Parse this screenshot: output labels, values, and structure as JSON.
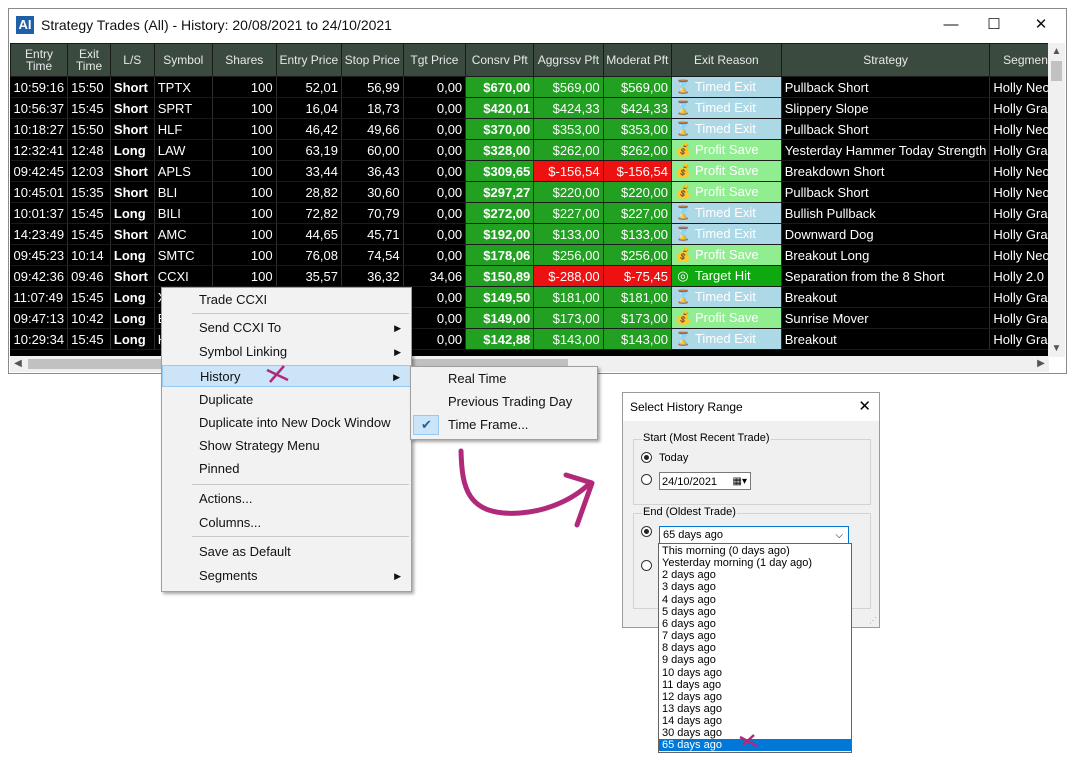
{
  "window": {
    "app_icon_label": "AI",
    "title": "Strategy Trades (All) - History: 20/08/2021 to 24/10/2021",
    "minimize_glyph": "—",
    "maximize_glyph": "☐",
    "close_glyph": "✕"
  },
  "grid": {
    "headers": [
      "Entry Time",
      "Exit Time",
      "L/S",
      "Symbol",
      "Shares",
      "Entry Price",
      "Stop Price",
      "Tgt Price",
      "Consrv Pft",
      "Aggrssv Pft",
      "Moderat Pft",
      "Exit Reason",
      "Strategy",
      "Segment"
    ],
    "rows": [
      {
        "entry": "10:59:16",
        "exit": "15:50",
        "ls": "Short",
        "symbol": "TPTX",
        "shares": "100",
        "entry_price": "52,01",
        "stop": "56,99",
        "tgt": "0,00",
        "cons": "$670,00",
        "aggr": "$569,00",
        "mod": "$569,00",
        "aggr_neg": false,
        "mod_neg": false,
        "reason": "Timed Exit",
        "reason_type": "timed",
        "strategy": "Pullback Short",
        "segment": "Holly Neo"
      },
      {
        "entry": "10:56:37",
        "exit": "15:45",
        "ls": "Short",
        "symbol": "SPRT",
        "shares": "100",
        "entry_price": "16,04",
        "stop": "18,73",
        "tgt": "0,00",
        "cons": "$420,01",
        "aggr": "$424,33",
        "mod": "$424,33",
        "aggr_neg": false,
        "mod_neg": false,
        "reason": "Timed Exit",
        "reason_type": "timed",
        "strategy": "Slippery Slope",
        "segment": "Holly Grail"
      },
      {
        "entry": "10:18:27",
        "exit": "15:50",
        "ls": "Short",
        "symbol": "HLF",
        "shares": "100",
        "entry_price": "46,42",
        "stop": "49,66",
        "tgt": "0,00",
        "cons": "$370,00",
        "aggr": "$353,00",
        "mod": "$353,00",
        "aggr_neg": false,
        "mod_neg": false,
        "reason": "Timed Exit",
        "reason_type": "timed",
        "strategy": "Pullback Short",
        "segment": "Holly Neo"
      },
      {
        "entry": "12:32:41",
        "exit": "12:48",
        "ls": "Long",
        "symbol": "LAW",
        "shares": "100",
        "entry_price": "63,19",
        "stop": "60,00",
        "tgt": "0,00",
        "cons": "$328,00",
        "aggr": "$262,00",
        "mod": "$262,00",
        "aggr_neg": false,
        "mod_neg": false,
        "reason": "Profit Save",
        "reason_type": "profit",
        "strategy": "Yesterday Hammer Today Strength",
        "segment": "Holly Grail"
      },
      {
        "entry": "09:42:45",
        "exit": "12:03",
        "ls": "Short",
        "symbol": "APLS",
        "shares": "100",
        "entry_price": "33,44",
        "stop": "36,43",
        "tgt": "0,00",
        "cons": "$309,65",
        "aggr": "$-156,54",
        "mod": "$-156,54",
        "aggr_neg": true,
        "mod_neg": true,
        "reason": "Profit Save",
        "reason_type": "profit",
        "strategy": "Breakdown Short",
        "segment": "Holly Neo"
      },
      {
        "entry": "10:45:01",
        "exit": "15:35",
        "ls": "Short",
        "symbol": "BLI",
        "shares": "100",
        "entry_price": "28,82",
        "stop": "30,60",
        "tgt": "0,00",
        "cons": "$297,27",
        "aggr": "$220,00",
        "mod": "$220,00",
        "aggr_neg": false,
        "mod_neg": false,
        "reason": "Profit Save",
        "reason_type": "profit",
        "strategy": "Pullback Short",
        "segment": "Holly Neo"
      },
      {
        "entry": "10:01:37",
        "exit": "15:45",
        "ls": "Long",
        "symbol": "BILI",
        "shares": "100",
        "entry_price": "72,82",
        "stop": "70,79",
        "tgt": "0,00",
        "cons": "$272,00",
        "aggr": "$227,00",
        "mod": "$227,00",
        "aggr_neg": false,
        "mod_neg": false,
        "reason": "Timed Exit",
        "reason_type": "timed",
        "strategy": "Bullish Pullback",
        "segment": "Holly Grail"
      },
      {
        "entry": "14:23:49",
        "exit": "15:45",
        "ls": "Short",
        "symbol": "AMC",
        "shares": "100",
        "entry_price": "44,65",
        "stop": "45,71",
        "tgt": "0,00",
        "cons": "$192,00",
        "aggr": "$133,00",
        "mod": "$133,00",
        "aggr_neg": false,
        "mod_neg": false,
        "reason": "Timed Exit",
        "reason_type": "timed",
        "strategy": "Downward Dog",
        "segment": "Holly Grail"
      },
      {
        "entry": "09:45:23",
        "exit": "10:14",
        "ls": "Long",
        "symbol": "SMTC",
        "shares": "100",
        "entry_price": "76,08",
        "stop": "74,54",
        "tgt": "0,00",
        "cons": "$178,06",
        "aggr": "$256,00",
        "mod": "$256,00",
        "aggr_neg": false,
        "mod_neg": false,
        "reason": "Profit Save",
        "reason_type": "profit",
        "strategy": "Breakout Long",
        "segment": "Holly Neo"
      },
      {
        "entry": "09:42:36",
        "exit": "09:46",
        "ls": "Short",
        "symbol": "CCXI",
        "shares": "100",
        "entry_price": "35,57",
        "stop": "36,32",
        "tgt": "34,06",
        "cons": "$150,89",
        "aggr": "$-288,00",
        "mod": "$-75,45",
        "aggr_neg": true,
        "mod_neg": true,
        "reason": "Target Hit",
        "reason_type": "target",
        "strategy": "Separation from the 8 Short",
        "segment": "Holly 2.0"
      },
      {
        "entry": "11:07:49",
        "exit": "15:45",
        "ls": "Long",
        "symbol": "X",
        "shares": "",
        "entry_price": "",
        "stop": "",
        "tgt": "0,00",
        "cons": "$149,50",
        "aggr": "$181,00",
        "mod": "$181,00",
        "aggr_neg": false,
        "mod_neg": false,
        "reason": "Timed Exit",
        "reason_type": "timed",
        "strategy": "Breakout",
        "segment": "Holly Grail"
      },
      {
        "entry": "09:47:13",
        "exit": "10:42",
        "ls": "Long",
        "symbol": "E",
        "shares": "",
        "entry_price": "",
        "stop": "",
        "tgt": "0,00",
        "cons": "$149,00",
        "aggr": "$173,00",
        "mod": "$173,00",
        "aggr_neg": false,
        "mod_neg": false,
        "reason": "Profit Save",
        "reason_type": "profit",
        "strategy": "Sunrise Mover",
        "segment": "Holly Grail"
      },
      {
        "entry": "10:29:34",
        "exit": "15:45",
        "ls": "Long",
        "symbol": "K",
        "shares": "",
        "entry_price": "",
        "stop": "",
        "tgt": "0,00",
        "cons": "$142,88",
        "aggr": "$143,00",
        "mod": "$143,00",
        "aggr_neg": false,
        "mod_neg": false,
        "reason": "Timed Exit",
        "reason_type": "timed",
        "strategy": "Breakout",
        "segment": "Holly Grail"
      }
    ]
  },
  "context_menu": {
    "items": [
      {
        "label": "Trade CCXI",
        "submenu": false
      },
      {
        "label": "Send CCXI To",
        "submenu": true
      },
      {
        "label": "Symbol Linking",
        "submenu": true
      },
      {
        "label": "History",
        "submenu": true,
        "highlight": true
      },
      {
        "label": "Duplicate",
        "submenu": false
      },
      {
        "label": "Duplicate into New Dock Window",
        "submenu": false
      },
      {
        "label": "Show Strategy Menu",
        "submenu": false
      },
      {
        "label": "Pinned",
        "submenu": false
      },
      {
        "label": "Actions...",
        "submenu": false
      },
      {
        "label": "Columns...",
        "submenu": false
      },
      {
        "label": "Save as Default",
        "submenu": false
      },
      {
        "label": "Segments",
        "submenu": true
      }
    ]
  },
  "history_submenu": {
    "items": [
      "Real Time",
      "Previous Trading Day",
      "Time Frame..."
    ],
    "checked": "Time Frame..."
  },
  "dialog": {
    "title": "Select History Range",
    "close_glyph": "✕",
    "start_label": "Start (Most Recent Trade)",
    "today_label": "Today",
    "date_value": "24/10/2021",
    "end_label": "End (Oldest Trade)",
    "end_selected": "65 days ago",
    "options": [
      "This morning (0 days ago)",
      "Yesterday morning (1 day ago)",
      "2 days ago",
      "3 days ago",
      "4 days ago",
      "5 days ago",
      "6 days ago",
      "7 days ago",
      "8 days ago",
      "9 days ago",
      "10 days ago",
      "11 days ago",
      "12 days ago",
      "13 days ago",
      "14 days ago",
      "30 days ago",
      "65 days ago"
    ]
  },
  "annotation_colors": {
    "marker": "#b02a79"
  }
}
